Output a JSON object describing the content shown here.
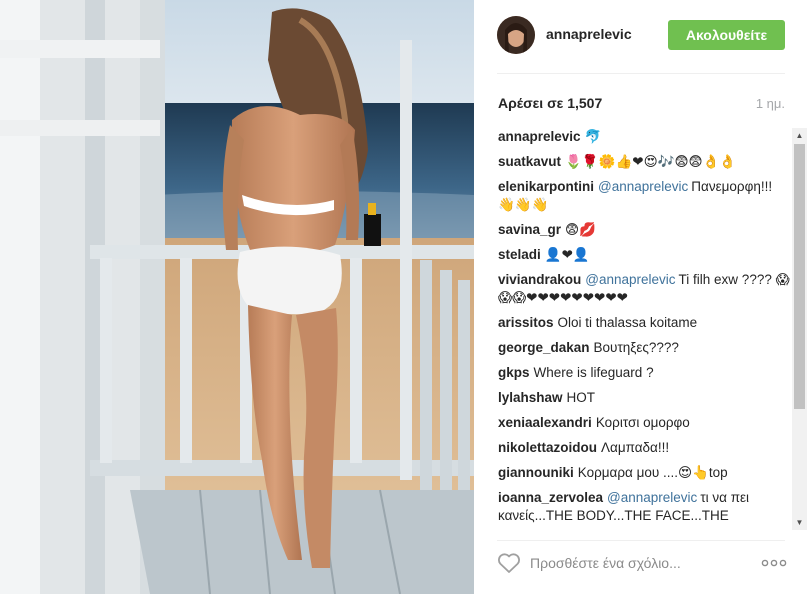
{
  "post": {
    "username": "annaprelevic",
    "follow_label": "Ακολουθείτε",
    "likes": "Αρέσει σε 1,507",
    "time": "1 ημ.",
    "comment_placeholder": "Προσθέστε ένα σχόλιο..."
  },
  "comments": [
    {
      "user": "annaprelevic",
      "mention": "",
      "text": "🐬"
    },
    {
      "user": "suatkavut",
      "mention": "",
      "text": "🌷🌹🌼👍❤😍🎶😨😨👌👌"
    },
    {
      "user": "elenikarpontini",
      "mention": "@annaprelevic",
      "text": "Πανεμορφη!!! 👋👋👋"
    },
    {
      "user": "savina_gr",
      "mention": "",
      "text": "😨💋"
    },
    {
      "user": "steladi",
      "mention": "",
      "text": "👤❤👤"
    },
    {
      "user": "viviandrakou",
      "mention": "@annaprelevic",
      "text": "Ti filh exw ???? 😱😱😱❤❤❤❤❤❤❤❤❤"
    },
    {
      "user": "arissitos",
      "mention": "",
      "text": "Oloi ti thalassa koitame"
    },
    {
      "user": "george_dakan",
      "mention": "",
      "text": "Βουτηξες????"
    },
    {
      "user": "gkps",
      "mention": "",
      "text": "Where is lifeguard ?"
    },
    {
      "user": "lylahshaw",
      "mention": "",
      "text": "HOT"
    },
    {
      "user": "xeniaalexandri",
      "mention": "",
      "text": "Κοριτσι ομορφο"
    },
    {
      "user": "nikolettazoidou",
      "mention": "",
      "text": "Λαμπαδα!!!"
    },
    {
      "user": "giannouniki",
      "mention": "",
      "text": "Κορμαρα μου ....😍👆top"
    },
    {
      "user": "ioanna_zervolea",
      "mention": "@annaprelevic",
      "text": "τι να πει κανείς...THE BODY...THE FACE...THE"
    }
  ],
  "colors": {
    "follow_bg": "#70c050",
    "mention": "#3f729b",
    "muted": "#a5a7aa"
  },
  "icons": [
    "heart-icon",
    "more-options-icon"
  ]
}
